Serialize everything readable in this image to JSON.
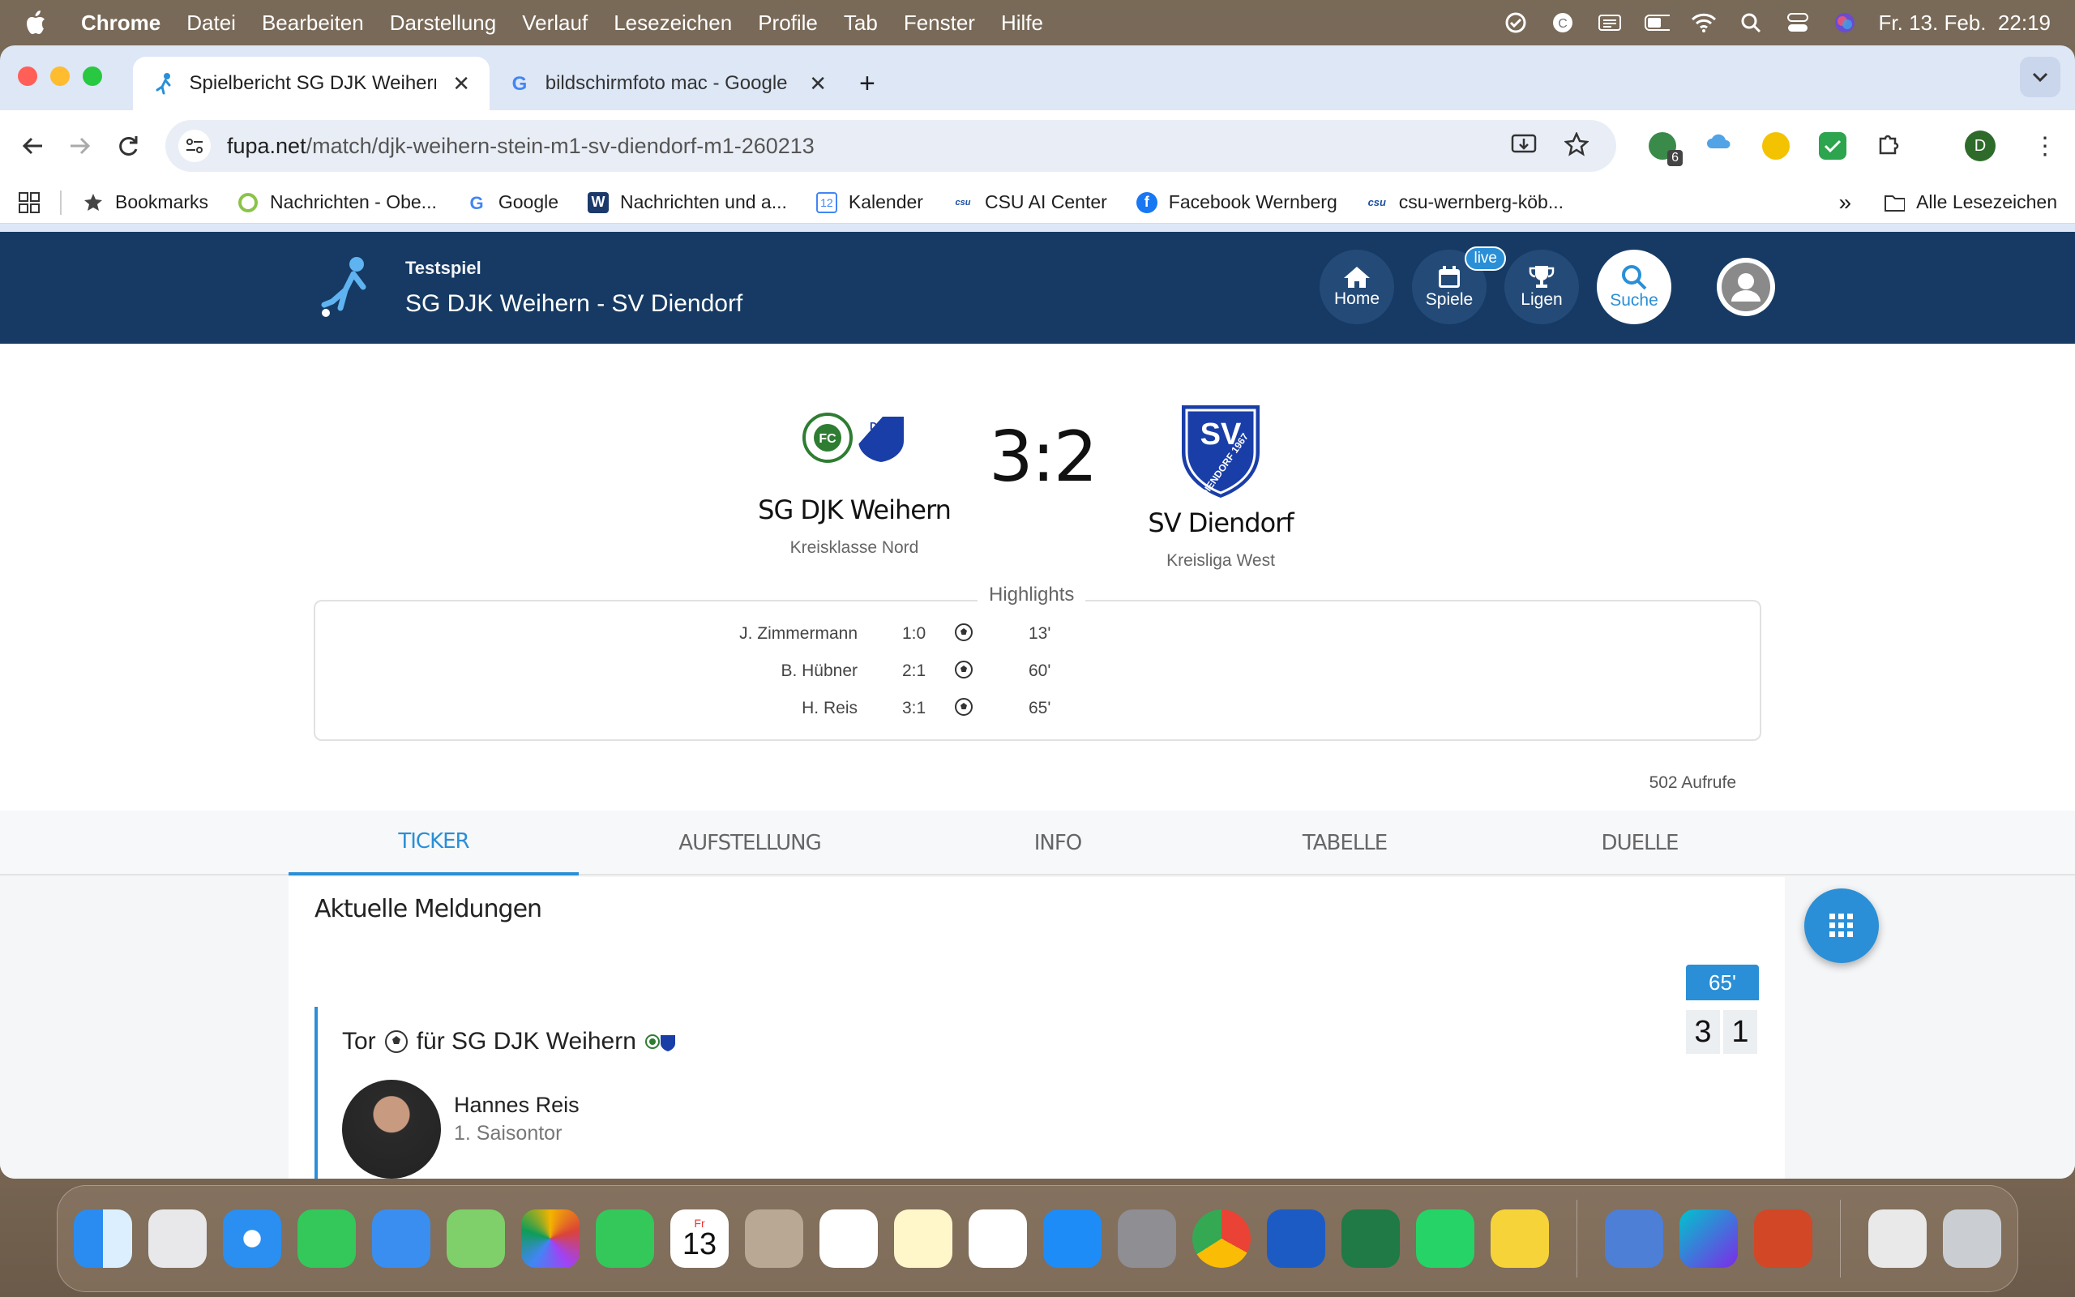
{
  "menubar": {
    "app": "Chrome",
    "items": [
      "Datei",
      "Bearbeiten",
      "Darstellung",
      "Verlauf",
      "Lesezeichen",
      "Profile",
      "Tab",
      "Fenster",
      "Hilfe"
    ],
    "datetime": "Fr. 13. Feb.  22:19"
  },
  "tabs": [
    {
      "title": "Spielbericht SG DJK Weihern"
    },
    {
      "title": "bildschirmfoto mac - Google S"
    }
  ],
  "toolbar": {
    "url_host": "fupa.net",
    "url_path": "/match/djk-weihern-stein-m1-sv-diendorf-m1-260213",
    "ext_badge": "6",
    "profile_initial": "D"
  },
  "bookmarks": {
    "items": [
      "Bookmarks",
      "Nachrichten - Obe...",
      "Google",
      "Nachrichten und a...",
      "Kalender",
      "CSU AI Center",
      "Facebook Wernberg",
      "csu-wernberg-köb..."
    ],
    "all": "Alle Lesezeichen"
  },
  "site": {
    "kicker": "Testspiel",
    "title": "SG DJK Weihern - SV Diendorf",
    "nav": [
      {
        "label": "Home",
        "icon": "home-icon"
      },
      {
        "label": "Spiele",
        "icon": "calendar-icon",
        "badge": "live"
      },
      {
        "label": "Ligen",
        "icon": "trophy-icon"
      },
      {
        "label": "Suche",
        "icon": "search-icon"
      }
    ]
  },
  "match": {
    "home": {
      "name": "SG DJK Weihern",
      "league": "Kreisklasse Nord"
    },
    "away": {
      "name": "SV Diendorf",
      "league": "Kreisliga West",
      "crest_text": "SV",
      "crest_sub": "DIENDORF 1967"
    },
    "score": "3:2",
    "highlights_title": "Highlights",
    "highlights": [
      {
        "player": "J. Zimmermann",
        "score": "1:0",
        "minute": "13'"
      },
      {
        "player": "B. Hübner",
        "score": "2:1",
        "minute": "60'"
      },
      {
        "player": "H. Reis",
        "score": "3:1",
        "minute": "65'"
      }
    ],
    "views": "502 Aufrufe"
  },
  "page_tabs": [
    "TICKER",
    "AUFSTELLUNG",
    "INFO",
    "TABELLE",
    "DUELLE"
  ],
  "ticker": {
    "heading": "Aktuelle Meldungen",
    "event": {
      "minute": "65'",
      "title_pre": "Tor",
      "title_post": "für SG DJK Weihern",
      "player": "Hannes Reis",
      "sub": "1. Saisontor",
      "score_home": "3",
      "score_away": "1"
    }
  },
  "colors": {
    "header": "#163a63",
    "accent": "#2a8fd6"
  },
  "dock": {
    "calendar_day": "13",
    "calendar_month": "Fr"
  }
}
